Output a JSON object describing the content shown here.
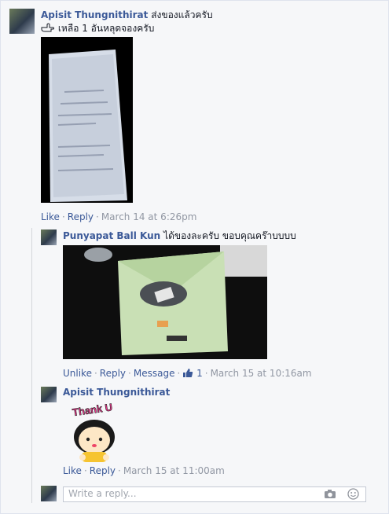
{
  "comment1": {
    "author": "Apisit Thungnithirat",
    "text": "ส่งของแล้วครับ",
    "subtext": "เหลือ 1 อันหลุดจองครับ",
    "actions": {
      "like": "Like",
      "reply": "Reply",
      "time": "March 14 at 6:26pm"
    }
  },
  "comment2": {
    "author": "Punyapat Ball Kun",
    "text": "ได้ของละครับ ขอบคุณคร๊าบบบบ",
    "actions": {
      "unlike": "Unlike",
      "reply": "Reply",
      "message": "Message",
      "like_count": "1",
      "time": "March 15 at 10:16am"
    }
  },
  "comment3": {
    "author": "Apisit Thungnithirat",
    "sticker_text": "Thank U",
    "actions": {
      "like": "Like",
      "reply": "Reply",
      "time": "March 15 at 11:00am"
    }
  },
  "reply_box": {
    "placeholder": "Write a reply..."
  },
  "icons": [
    "thumbs-up-icon",
    "camera-icon",
    "emoji-icon"
  ],
  "colors": {
    "link": "#3b5998",
    "meta": "#9197a3",
    "background": "#f6f7f9"
  }
}
